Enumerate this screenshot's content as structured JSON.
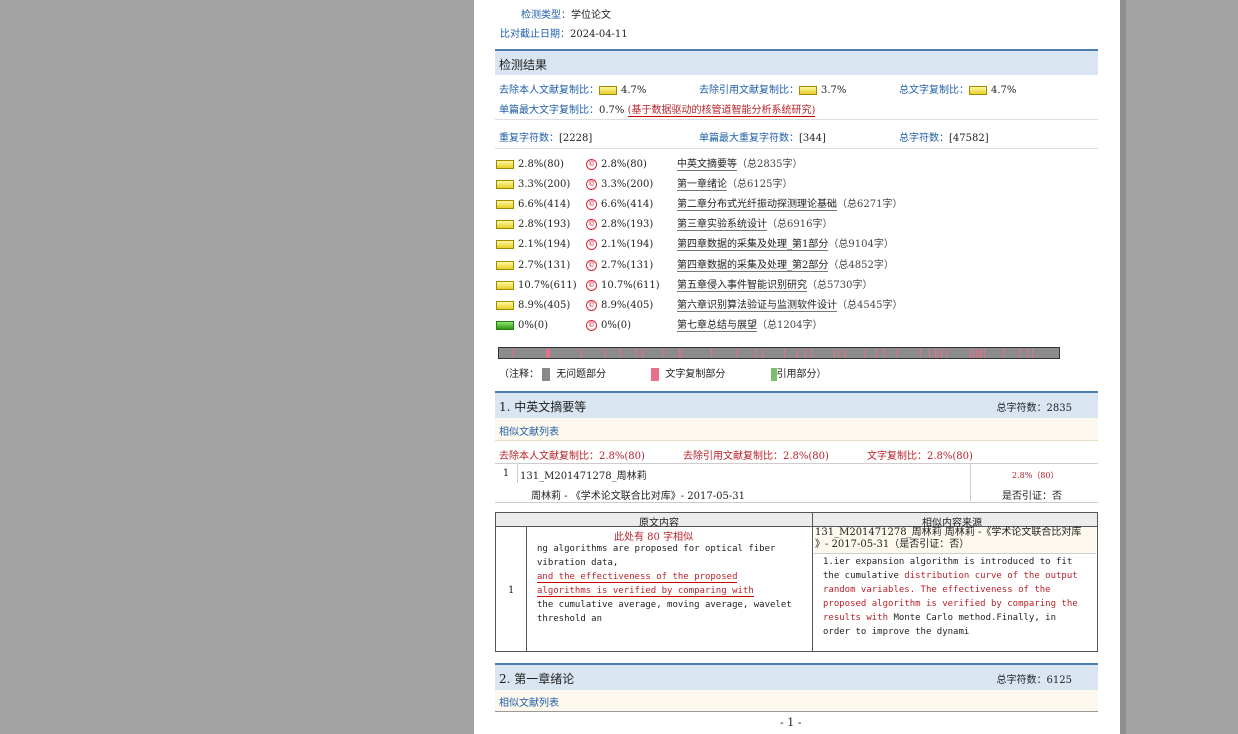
{
  "header": {
    "type_label": "检测类型：",
    "type_value": "学位论文",
    "date_label": "比对截止日期：",
    "date_value": "2024-04-11"
  },
  "results": {
    "title": "检测结果",
    "excl_self_label": "去除本人文献复制比：",
    "excl_self_value": "4.7%",
    "excl_cite_label": "去除引用文献复制比：",
    "excl_cite_value": "3.7%",
    "total_copy_label": "总文字复制比：",
    "total_copy_value": "4.7%",
    "max_single_label": "单篇最大文字复制比：",
    "max_single_value": "0.7%",
    "max_single_title": "(基于数据驱动的核管道智能分析系统研究)",
    "repeat_chars_label": "重复字符数：",
    "repeat_chars_value": "[2228]",
    "max_repeat_label": "单篇最大重复字符数：",
    "max_repeat_value": "[344]",
    "total_chars_label": "总字符数：",
    "total_chars_value": "[47582]"
  },
  "chapters": [
    {
      "ratio": "2.8%(80)",
      "ratio2": "2.8%(80)",
      "title": "中英文摘要等",
      "total": "（总2835字）"
    },
    {
      "ratio": "3.3%(200)",
      "ratio2": "3.3%(200)",
      "title": "第一章绪论",
      "total": "（总6125字）"
    },
    {
      "ratio": "6.6%(414)",
      "ratio2": "6.6%(414)",
      "title": "第二章分布式光纤振动探测理论基础",
      "total": "（总6271字）"
    },
    {
      "ratio": "2.8%(193)",
      "ratio2": "2.8%(193)",
      "title": "第三章实验系统设计",
      "total": "（总6916字）"
    },
    {
      "ratio": "2.1%(194)",
      "ratio2": "2.1%(194)",
      "title": "第四章数据的采集及处理_第1部分",
      "total": "（总9104字）"
    },
    {
      "ratio": "2.7%(131)",
      "ratio2": "2.7%(131)",
      "title": "第四章数据的采集及处理_第2部分",
      "total": "（总4852字）"
    },
    {
      "ratio": "10.7%(611)",
      "ratio2": "10.7%(611)",
      "title": "第五章侵入事件智能识别研究",
      "total": "（总5730字）"
    },
    {
      "ratio": "8.9%(405)",
      "ratio2": "8.9%(405)",
      "title": "第六章识别算法验证与监测软件设计",
      "total": "（总4545字）"
    },
    {
      "ratio": "0%(0)",
      "ratio2": "0%(0)",
      "title": "第七章总结与展望",
      "total": "（总1204字）"
    }
  ],
  "legend": {
    "prefix": "（注释：",
    "no_issue": "无问题部分",
    "copy_part": "文字复制部分",
    "cite_part": "引用部分）"
  },
  "section1": {
    "title": "1. 中英文摘要等",
    "total_label": "总字符数：",
    "total_value": "2835",
    "similar_list": "相似文献列表",
    "excl_self": "去除本人文献复制比：2.8%(80)",
    "excl_cite": "去除引用文献复制比：2.8%(80)",
    "copy_ratio": "文字复制比：2.8%(80)",
    "doc_index": "1",
    "doc_title": "131_M201471278_周林莉",
    "doc_ratio": "2.8%（80）",
    "doc_source": "周林莉 - 《学术论文联合比对库》- 2017-05-31",
    "doc_cite": "是否引证：否",
    "col_orig": "原文内容",
    "col_similar": "相似内容来源",
    "row_index": "1",
    "similar_note": "此处有 80 字相似",
    "orig_line1": "ng algorithms are proposed for optical fiber",
    "orig_line2": "vibration data,",
    "orig_hl1": " and the effectiveness of the proposed",
    "orig_hl2": "algorithms is verified by comparing with",
    "orig_line3": "the cumulative average, moving average, wavelet",
    "orig_line4": "threshold an",
    "src_title_line1": "131_M201471278_周林莉  周林莉 -《学术论文联合比对库",
    "src_title_line2": "》- 2017-05-31（是否引证：否）",
    "src_p1": "1.ier expansion algorithm is introduced to fit",
    "src_p2a": "the cumulative ",
    "src_p2b": "distribution curve of the output",
    "src_p3": "random variables. The effectiveness of the",
    "src_p4": "proposed algorithm is verified by comparing the",
    "src_p5a": "results with",
    "src_p5b": " Monte Carlo method.Finally, in",
    "src_p6": "order to improve the dynami"
  },
  "section2": {
    "title": "2. 第一章绪论",
    "total_label": "总字符数：",
    "total_value": "6125",
    "similar_list": "相似文献列表"
  },
  "footer": {
    "page_num": "- 1 -"
  },
  "colors": {
    "accent": "#1f5fa8",
    "highlight": "#b8232b",
    "section_bg": "#d9e5f1"
  }
}
